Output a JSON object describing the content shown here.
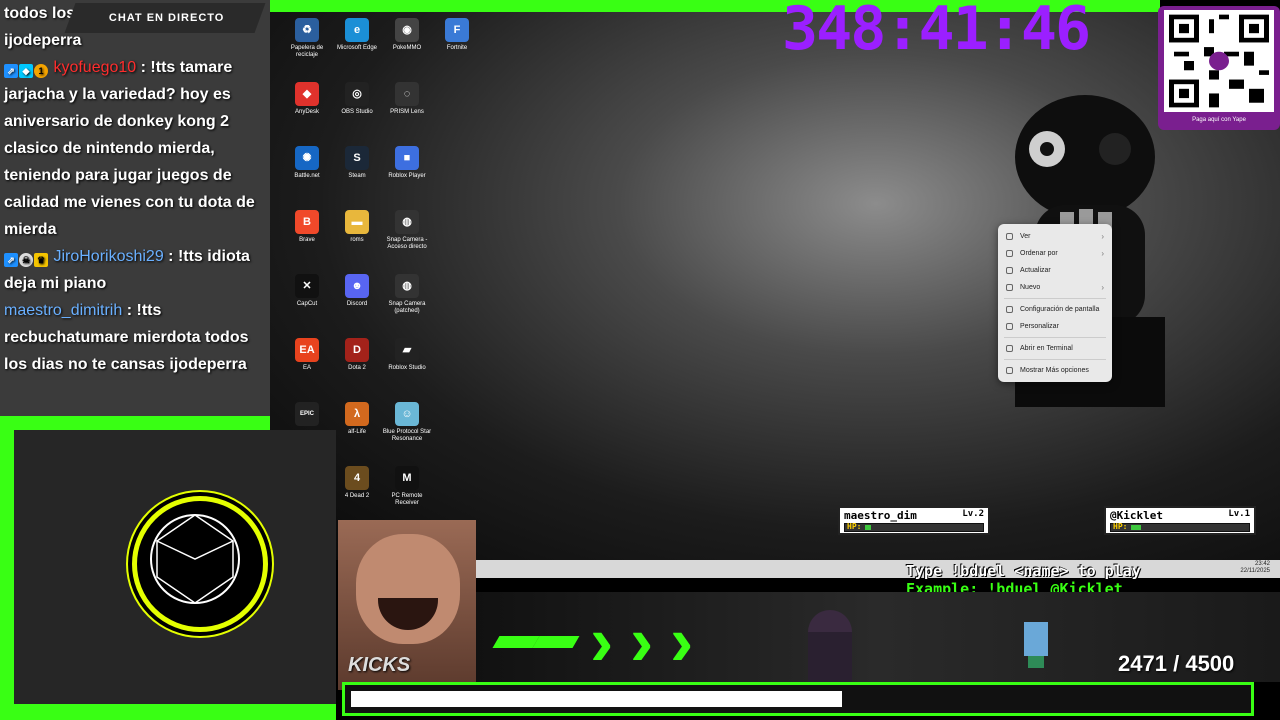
{
  "chat": {
    "title": "CHAT EN DIRECTO",
    "top_cut_1": "todos los dias no te cansas",
    "top_cut_2": "ijodeperra",
    "messages": [
      {
        "user": "kyofuego10",
        "text": ": !tts tamare jarjacha y la variedad? hoy es aniversario de donkey kong 2 clasico de nintendo mierda, teniendo para jugar juegos de calidad me vienes con tu dota de mierda"
      },
      {
        "user": "JiroHorikoshi29",
        "text": ": !tts idiota deja mi piano"
      },
      {
        "user": "maestro_dimitrih",
        "text": ": !tts recbuchatumare mierdota todos los dias no te cansas ijodeperra"
      }
    ]
  },
  "timer": "348:41:46",
  "qr_caption": "Paga aquí con Yape",
  "desktop_icons": [
    {
      "label": "Papelera de reciclaje",
      "icon": "recycle-bin-icon",
      "color": "#2b5f9e",
      "glyph": "♻"
    },
    {
      "label": "Microsoft Edge",
      "icon": "edge-icon",
      "color": "#1b8fd6",
      "glyph": "e"
    },
    {
      "label": "PokeMMO",
      "icon": "pokemmo-icon",
      "color": "#444",
      "glyph": "◉"
    },
    {
      "label": "Fortnite",
      "icon": "fortnite-icon",
      "color": "#3a7ad6",
      "glyph": "F"
    },
    {
      "label": "AnyDesk",
      "icon": "anydesk-icon",
      "color": "#e0322c",
      "glyph": "◆"
    },
    {
      "label": "OBS Studio",
      "icon": "obs-icon",
      "color": "#222",
      "glyph": "◎"
    },
    {
      "label": "PRISM Lens",
      "icon": "prism-icon",
      "color": "#333",
      "glyph": "◌"
    },
    {
      "label": "Battle.net",
      "icon": "battlenet-icon",
      "color": "#1667c4",
      "glyph": "✺"
    },
    {
      "label": "Steam",
      "icon": "steam-icon",
      "color": "#1b2838",
      "glyph": "S"
    },
    {
      "label": "Roblox Player",
      "icon": "roblox-icon",
      "color": "#3d6fe0",
      "glyph": "■"
    },
    {
      "label": "Brave",
      "icon": "brave-icon",
      "color": "#f0492a",
      "glyph": "B"
    },
    {
      "label": "roms",
      "icon": "folder-icon",
      "color": "#e8b73c",
      "glyph": "▬"
    },
    {
      "label": "Snap Camera - Acceso directo",
      "icon": "snap-camera-icon",
      "color": "#333",
      "glyph": "◍"
    },
    {
      "label": "CapCut",
      "icon": "capcut-icon",
      "color": "#111",
      "glyph": "✕"
    },
    {
      "label": "Discord",
      "icon": "discord-icon",
      "color": "#5865f2",
      "glyph": "☻"
    },
    {
      "label": "Snap Camera (patched)",
      "icon": "snap-camera-icon",
      "color": "#333",
      "glyph": "◍"
    },
    {
      "label": "EA",
      "icon": "ea-icon",
      "color": "#e8431e",
      "glyph": "EA"
    },
    {
      "label": "Dota 2",
      "icon": "dota2-icon",
      "color": "#a3221a",
      "glyph": "D"
    },
    {
      "label": "Roblox Studio",
      "icon": "roblox-studio-icon",
      "color": "#222",
      "glyph": "▰"
    },
    {
      "label": "",
      "icon": "epic-games-icon",
      "color": "#222",
      "glyph": "EPIC"
    },
    {
      "label": "alf-Life",
      "icon": "half-life-icon",
      "color": "#d2691e",
      "glyph": "λ"
    },
    {
      "label": "Blue Protocol Star Resonance",
      "icon": "blue-protocol-icon",
      "color": "#6ab7d6",
      "glyph": "☺"
    },
    {
      "label": "4 Dead 2",
      "icon": "left4dead-icon",
      "color": "#6b4c1e",
      "glyph": "4"
    },
    {
      "label": "PC Remote Receiver",
      "icon": "pc-remote-icon",
      "color": "#111",
      "glyph": "M"
    }
  ],
  "context_menu": [
    {
      "label": "Ver",
      "sub": true
    },
    {
      "label": "Ordenar por",
      "sub": true
    },
    {
      "label": "Actualizar",
      "sub": false
    },
    {
      "label": "Nuevo",
      "sub": true
    },
    {
      "sep": true
    },
    {
      "label": "Configuración de pantalla",
      "sub": false
    },
    {
      "label": "Personalizar",
      "sub": false
    },
    {
      "sep": true
    },
    {
      "label": "Abrir en Terminal",
      "sub": false
    },
    {
      "sep": true
    },
    {
      "label": "Mostrar Más opciones",
      "sub": false
    }
  ],
  "duel": {
    "player1": {
      "name": "maestro_dim",
      "level": "Lv.2",
      "hp_label": "HP:",
      "hp": 0.05
    },
    "player2": {
      "name": "@Kicklet",
      "level": "Lv.1",
      "hp_label": "HP:",
      "hp": 0.08
    },
    "instruction": "Type !bduel <name> to play",
    "example": "Example: !bduel @Kicklet"
  },
  "taskbar_clock": {
    "time": "23:42",
    "date": "22/11/2025"
  },
  "meme_label": "KICKS",
  "goal": {
    "current": 2471,
    "separator": "/",
    "target": 4500,
    "progress": 0.549
  }
}
